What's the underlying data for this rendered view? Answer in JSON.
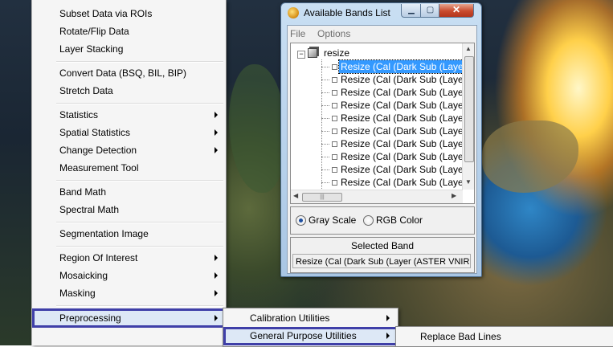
{
  "main_menu": {
    "items": [
      {
        "label": "Subset Data via ROIs",
        "submenu": false
      },
      {
        "label": "Rotate/Flip Data",
        "submenu": false
      },
      {
        "label": "Layer Stacking",
        "submenu": false
      },
      {
        "label": "Convert Data (BSQ, BIL, BIP)",
        "submenu": false
      },
      {
        "label": "Stretch Data",
        "submenu": false
      },
      {
        "label": "Statistics",
        "submenu": true
      },
      {
        "label": "Spatial Statistics",
        "submenu": true
      },
      {
        "label": "Change Detection",
        "submenu": true
      },
      {
        "label": "Measurement Tool",
        "submenu": false
      },
      {
        "label": "Band Math",
        "submenu": false
      },
      {
        "label": "Spectral Math",
        "submenu": false
      },
      {
        "label": "Segmentation Image",
        "submenu": false
      },
      {
        "label": "Region Of Interest",
        "submenu": true
      },
      {
        "label": "Mosaicking",
        "submenu": true
      },
      {
        "label": "Masking",
        "submenu": true
      },
      {
        "label": "Preprocessing",
        "submenu": true,
        "highlighted": true
      }
    ]
  },
  "preprocessing_submenu": {
    "items": [
      {
        "label": "Calibration Utilities",
        "submenu": true
      },
      {
        "label": "General Purpose Utilities",
        "submenu": true,
        "highlighted": true
      }
    ]
  },
  "general_purpose_submenu": {
    "items": [
      {
        "label": "Replace Bad Lines"
      }
    ]
  },
  "bands_window": {
    "title": "Available Bands List",
    "menubar": [
      "File",
      "Options"
    ],
    "tree": {
      "root": "resize",
      "bands": [
        "Resize (Cal (Dark Sub (Layer (",
        "Resize (Cal (Dark Sub (Layer (",
        "Resize (Cal (Dark Sub (Layer (",
        "Resize (Cal (Dark Sub (Layer (",
        "Resize (Cal (Dark Sub (Layer (",
        "Resize (Cal (Dark Sub (Layer (",
        "Resize (Cal (Dark Sub (Layer (",
        "Resize (Cal (Dark Sub (Layer (",
        "Resize (Cal (Dark Sub (Layer (",
        "Resize (Cal (Dark Sub (Layer ("
      ],
      "selected_index": 0
    },
    "display_mode": {
      "gray_scale": "Gray Scale",
      "rgb_color": "RGB Color",
      "selected": "gray_scale"
    },
    "selected_band": {
      "header": "Selected Band",
      "value": "Resize (Cal (Dark Sub (Layer (ASTER VNIR E"
    }
  },
  "colors": {
    "highlight_outline": "#3f3fa8",
    "tree_selection": "#3399ff",
    "close_button": "#c94b2d"
  }
}
